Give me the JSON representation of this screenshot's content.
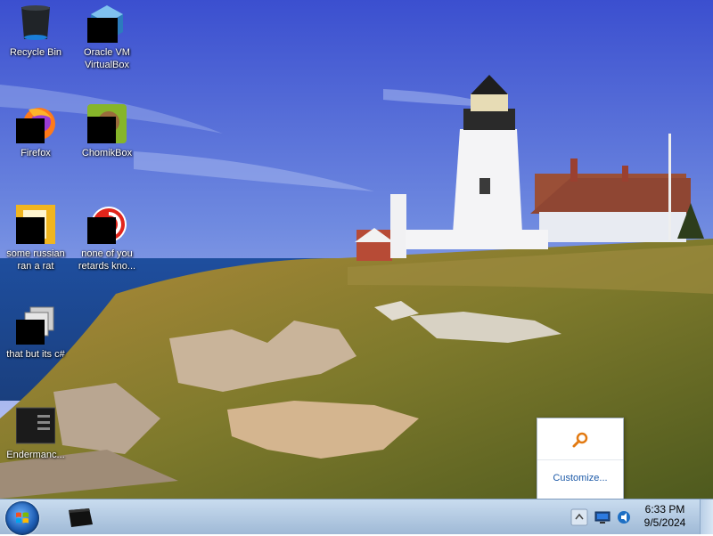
{
  "desktop": {
    "icons": [
      {
        "label": "Recycle Bin",
        "icon": "recycle-bin-icon"
      },
      {
        "label": "Oracle VM VirtualBox",
        "icon": "virtualbox-icon"
      },
      {
        "label": "Firefox",
        "icon": "firefox-icon"
      },
      {
        "label": "ChomikBox",
        "icon": "chomikbox-icon"
      },
      {
        "label": "some russian ran a rat",
        "icon": "app-icon-yellow"
      },
      {
        "label": "none of you retards kno...",
        "icon": "app-icon-red"
      },
      {
        "label": "that but its c#",
        "icon": "documents-icon"
      },
      {
        "label": "Endermanc...",
        "icon": "terminal-icon"
      }
    ]
  },
  "taskbar": {
    "pinned": [
      {
        "icon": "cmd-window-icon"
      }
    ],
    "tray_icons": [
      "tray-arrow-icon",
      "network-icon",
      "speaker-icon"
    ],
    "clock": {
      "time": "6:33 PM",
      "date": "9/5/2024"
    }
  },
  "tray_popup": {
    "customize_label": "Customize...",
    "icon": "search-icon"
  },
  "colors": {
    "taskbar_top": "#c9dcef",
    "taskbar_bottom": "#9fb9d6",
    "popup_link": "#1d5aa8"
  }
}
